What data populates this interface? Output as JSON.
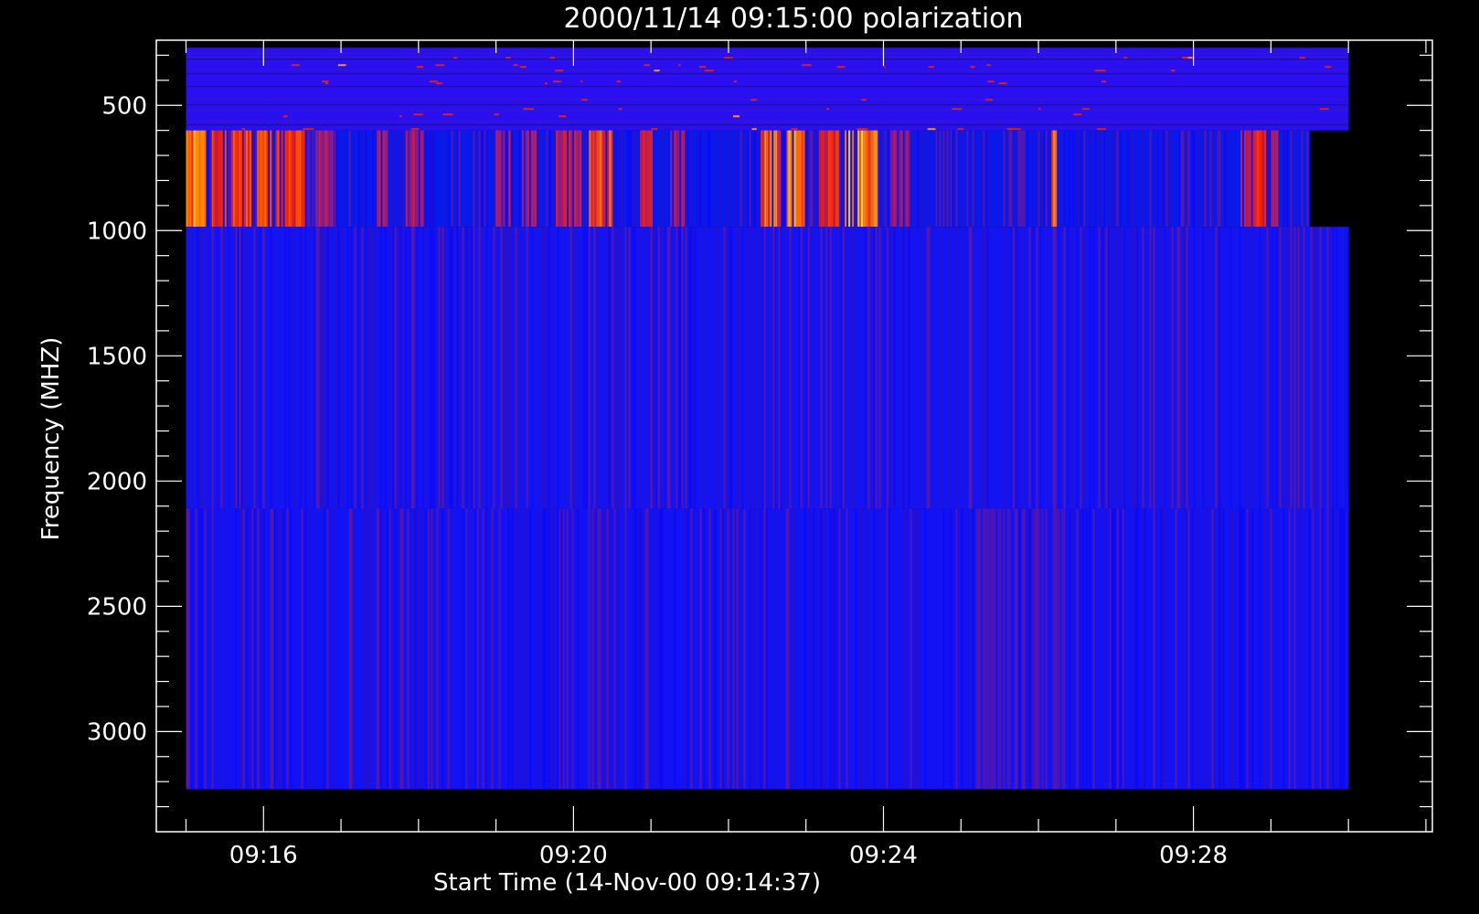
{
  "chart_data": {
    "type": "heatmap",
    "title": "2000/11/14 09:15:00 polarization",
    "xlabel": "Start Time (14-Nov-00 09:14:37)",
    "ylabel": "Frequency (MHZ)",
    "xlim": [
      "09:14:37",
      "09:31:05"
    ],
    "ylim": [
      3400,
      240
    ],
    "y_reversed": true,
    "x_ticks": [
      "09:16",
      "09:20",
      "09:24",
      "09:28"
    ],
    "y_ticks": [
      500,
      1000,
      1500,
      2000,
      2500,
      3000
    ],
    "data_time_range": [
      "09:15:00",
      "09:30:00"
    ],
    "colormap": [
      "#0000ff",
      "#8a1a8a",
      "#ff2200",
      "#ff8c00",
      "#ffff60"
    ],
    "frequency_bands": [
      {
        "freq_range": [
          270,
          600
        ],
        "pattern": "noisy-rows",
        "dominant": "#2a10f0"
      },
      {
        "freq_range": [
          600,
          985
        ],
        "pattern": "vertical-bursts",
        "dominant": "#0a18ea",
        "bursts": [
          {
            "time_range": [
              "09:15:00",
              "09:15:15"
            ],
            "intensity": 0.85
          },
          {
            "time_range": [
              "09:15:20",
              "09:15:30"
            ],
            "intensity": 0.6
          },
          {
            "time_range": [
              "09:15:35",
              "09:15:50"
            ],
            "intensity": 0.65
          },
          {
            "time_range": [
              "09:15:55",
              "09:16:05"
            ],
            "intensity": 0.75
          },
          {
            "time_range": [
              "09:16:08",
              "09:16:32"
            ],
            "intensity": 0.62
          },
          {
            "time_range": [
              "09:16:40",
              "09:16:55"
            ],
            "intensity": 0.4
          },
          {
            "time_range": [
              "09:17:25",
              "09:17:35"
            ],
            "intensity": 0.45
          },
          {
            "time_range": [
              "09:17:50",
              "09:18:05"
            ],
            "intensity": 0.4
          },
          {
            "time_range": [
              "09:19:00",
              "09:19:10"
            ],
            "intensity": 0.4
          },
          {
            "time_range": [
              "09:19:20",
              "09:19:30"
            ],
            "intensity": 0.45
          },
          {
            "time_range": [
              "09:19:45",
              "09:20:05"
            ],
            "intensity": 0.5
          },
          {
            "time_range": [
              "09:20:12",
              "09:20:30"
            ],
            "intensity": 0.7
          },
          {
            "time_range": [
              "09:20:50",
              "09:21:00"
            ],
            "intensity": 0.45
          },
          {
            "time_range": [
              "09:21:15",
              "09:21:25"
            ],
            "intensity": 0.4
          },
          {
            "time_range": [
              "09:22:25",
              "09:22:40"
            ],
            "intensity": 0.8
          },
          {
            "time_range": [
              "09:22:45",
              "09:22:58"
            ],
            "intensity": 0.85
          },
          {
            "time_range": [
              "09:23:10",
              "09:23:25"
            ],
            "intensity": 0.55
          },
          {
            "time_range": [
              "09:23:30",
              "09:23:55"
            ],
            "intensity": 0.9
          },
          {
            "time_range": [
              "09:24:05",
              "09:24:20"
            ],
            "intensity": 0.35
          },
          {
            "time_range": [
              "09:26:10",
              "09:26:13"
            ],
            "intensity": 0.9
          },
          {
            "time_range": [
              "09:28:35",
              "09:28:55"
            ],
            "intensity": 0.55
          },
          {
            "time_range": [
              "09:29:00",
              "09:29:05"
            ],
            "intensity": 0.4
          }
        ]
      },
      {
        "freq_range": [
          985,
          2110
        ],
        "pattern": "faint-stripes",
        "dominant": "#1414f0"
      },
      {
        "freq_range": [
          2110,
          3230
        ],
        "pattern": "faint-stripes",
        "dominant": "#1212f2",
        "enhancement": {
          "time_range": [
            "09:25:10",
            "09:26:30"
          ],
          "color": "#5a1aa8"
        }
      }
    ],
    "band_edges_data_end": [
      "09:30:00",
      "09:29:30",
      "09:30:00",
      "09:30:00"
    ]
  }
}
